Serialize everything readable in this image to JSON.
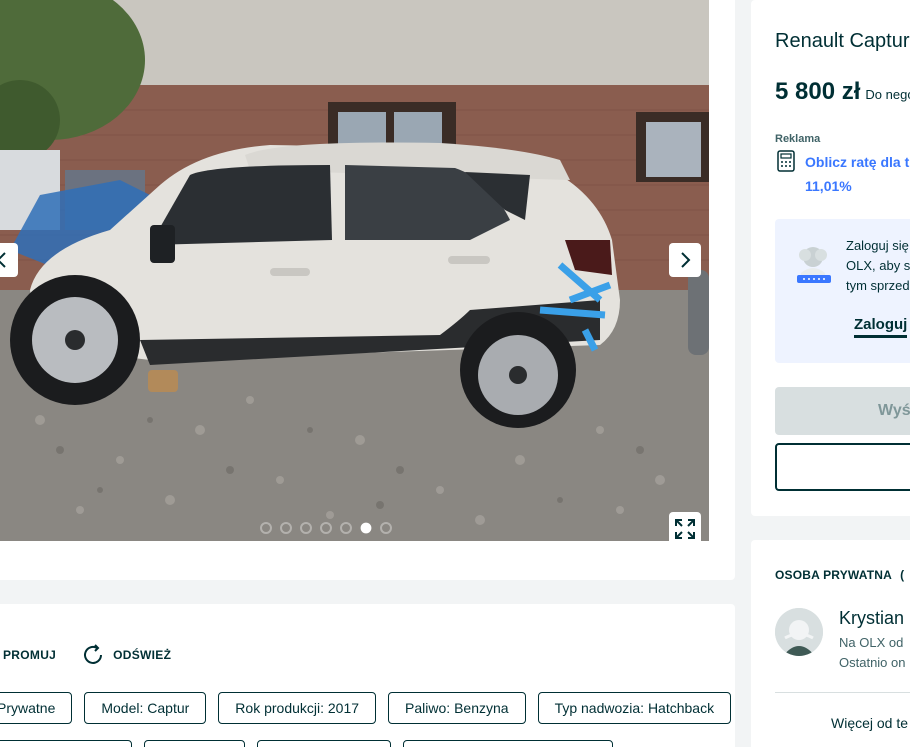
{
  "gallery": {
    "image_alt": "White Renault Captur, damaged front and rear, parked on gravel",
    "photo_count": 7,
    "active_index": 5,
    "prev_icon": "chevron-left-icon",
    "next_icon": "chevron-right-icon",
    "expand_icon": "expand-icon"
  },
  "actions": {
    "promote": "PROMUJ",
    "refresh": "ODŚWIEŻ"
  },
  "tags": [
    "Prywatne",
    "Model: Captur",
    "Rok produkcji: 2017",
    "Paliwo: Benzyna",
    "Typ nadwozia: Hatchback"
  ],
  "offer": {
    "title": "Renault Captur p",
    "price": "5 800 zł",
    "negotiable": "Do nego",
    "ad_label": "Reklama",
    "calc_line1": "Oblicz ratę dla t",
    "calc_line2": "11,01%"
  },
  "login_box": {
    "line1": "Zaloguj się",
    "line2": "OLX, aby s",
    "line3": "tym sprzed",
    "link": "Zaloguj"
  },
  "buttons": {
    "send": "Wyś"
  },
  "seller": {
    "type": "OSOBA PRYWATNA",
    "type_extra": "(",
    "name": "Krystian",
    "since": "Na OLX od",
    "online": "Ostatnio on",
    "more": "Więcej od te"
  },
  "colors": {
    "brand_dark": "#002f34",
    "accent_blue": "#3a77ff",
    "background": "#f2f4f5",
    "login_bg": "#eef3ff"
  }
}
